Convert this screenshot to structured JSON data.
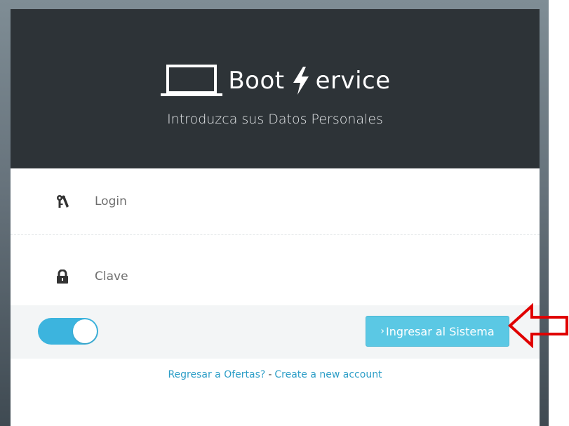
{
  "brand": {
    "part1": "Boot",
    "part2": "ervice",
    "subtitle": "Introduzca sus Datos Personales"
  },
  "form": {
    "login_placeholder": "Login",
    "password_placeholder": "Clave",
    "remember_toggle_on": true,
    "submit_chevron": "›",
    "submit_label": "Ingresar al Sistema"
  },
  "links": {
    "back_to_offers": "Regresar a Ofertas?",
    "separator": "-",
    "create_account": "Create a new account"
  },
  "icons": {
    "brand_logo": "laptop-icon",
    "brand_bolt": "lightning-bolt-icon",
    "login": "keys-icon",
    "password": "lock-icon",
    "annotation": "red-arrow-icon"
  },
  "colors": {
    "header_bg": "#2d3337",
    "accent": "#3cb4de",
    "button_bg": "#5bc8e4",
    "link": "#2d9ec7",
    "annotation_red": "#e00000"
  }
}
